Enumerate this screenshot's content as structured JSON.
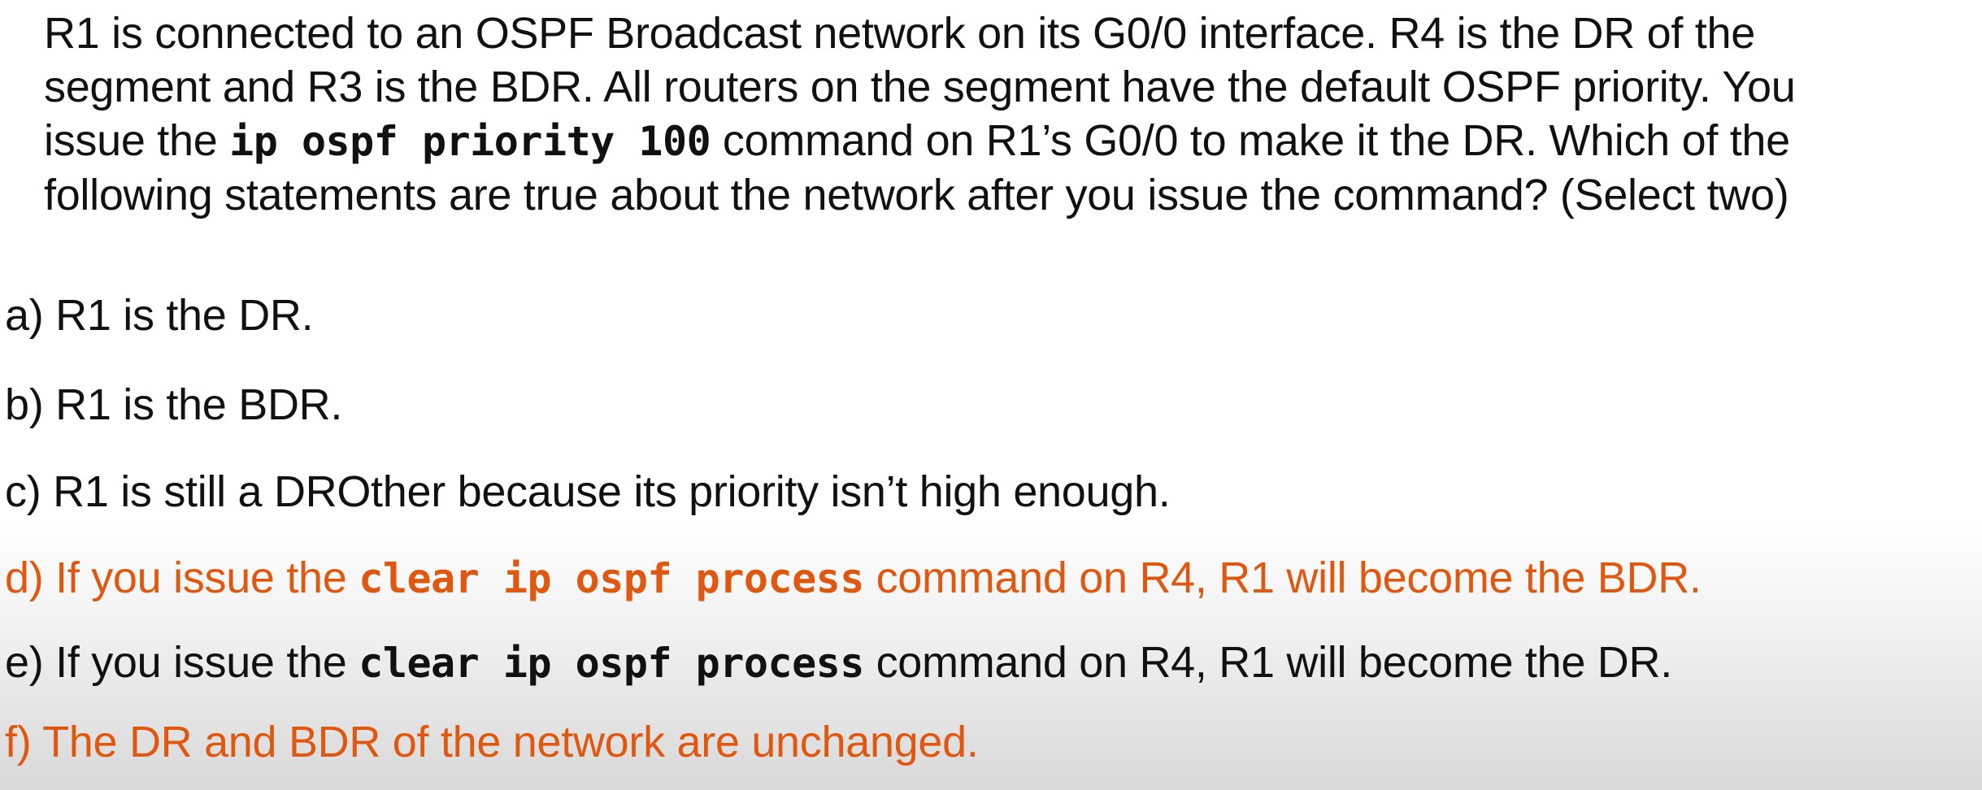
{
  "question": {
    "line1": "R1 is connected to an OSPF Broadcast network on its G0/0 interface.  R4 is the DR of the",
    "line2": "segment and R3 is the BDR.  All routers on the segment have the default OSPF priority.  You",
    "line3_pre": "issue the ",
    "line3_cmd": "ip ospf priority 100",
    "line3_post": " command on R1’s G0/0 to make it the DR.  Which of the",
    "line4": "following statements are true about the network after you issue the command? (Select two)"
  },
  "options": {
    "a": "a) R1 is the DR.",
    "b": "b) R1 is the BDR.",
    "c": "c) R1 is still a DROther because its priority isn’t high enough.",
    "d_pre": "d) If you issue the ",
    "d_cmd": "clear ip ospf process",
    "d_post": " command on R4, R1 will become the BDR.",
    "e_pre": "e) If you issue the ",
    "e_cmd": "clear ip ospf process",
    "e_post": " command on R4, R1 will become the DR.",
    "f": "f) The DR and BDR of the network are unchanged."
  },
  "colors": {
    "text": "#111111",
    "correct_answer": "#e0580f"
  }
}
